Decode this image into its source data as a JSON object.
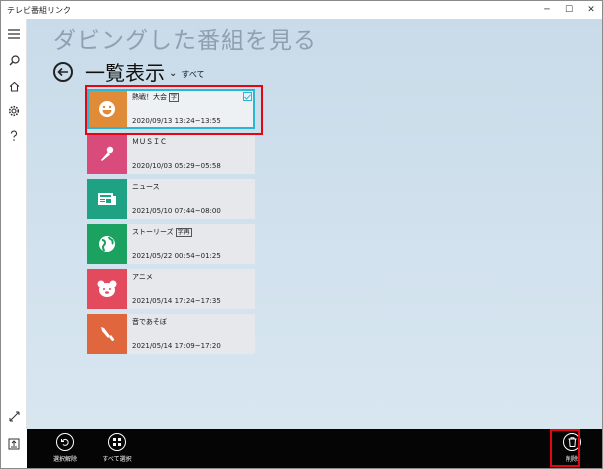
{
  "window": {
    "title": "テレビ番組リンク",
    "minimize": "─",
    "maximize": "☐",
    "close": "✕"
  },
  "page": {
    "heading": "ダビングした番組を見る",
    "view_title": "一覧表示",
    "view_caret": "⌄",
    "view_filter": "すべて"
  },
  "items": [
    {
      "title": "熱戦！大会",
      "badge": "字",
      "date": "2020/09/13 13:24~13:55",
      "color": "#e08b38",
      "icon": "smile-icon",
      "selected": true
    },
    {
      "title": "ＭＵＳＩＣ",
      "badge": "",
      "date": "2020/10/03 05:29~05:58",
      "color": "#d94b7b",
      "icon": "microphone-icon",
      "selected": false
    },
    {
      "title": "ニュース",
      "badge": "",
      "date": "2021/05/10 07:44~08:00",
      "color": "#1fa184",
      "icon": "newspaper-icon",
      "selected": false
    },
    {
      "title": "ストーリーズ",
      "badge": "字再",
      "date": "2021/05/22 00:54~01:25",
      "color": "#1ba160",
      "icon": "globe-icon",
      "selected": false
    },
    {
      "title": "アニメ",
      "badge": "",
      "date": "2021/05/14 17:24~17:35",
      "color": "#e34a5d",
      "icon": "bear-icon",
      "selected": false
    },
    {
      "title": "音であそぼ",
      "badge": "",
      "date": "2021/05/14 17:09~17:20",
      "color": "#e0663e",
      "icon": "brush-icon",
      "selected": false
    }
  ],
  "appbar": {
    "deselect_label": "選択解除",
    "select_all_label": "すべて選択",
    "delete_label": "削除"
  }
}
